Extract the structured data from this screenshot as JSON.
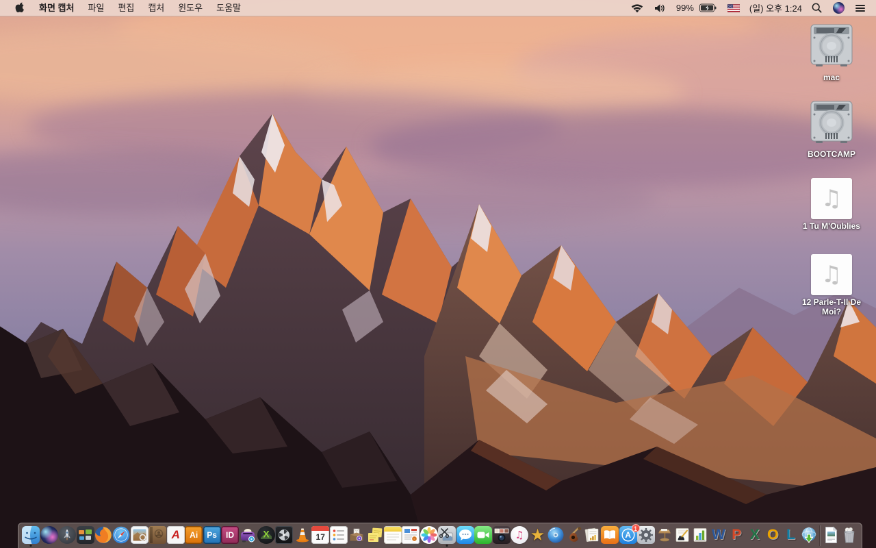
{
  "menu_bar": {
    "menus": [
      "화면 캡처",
      "파일",
      "편집",
      "캡처",
      "윈도우",
      "도움말"
    ],
    "active_app": "화면 캡처",
    "status": {
      "battery_percent": "99%",
      "clock": "(일) 오후 1:24"
    },
    "status_icons": [
      "wifi-icon",
      "volume-icon",
      "battery-charging-icon",
      "us-flag-input-icon",
      "spotlight-search-icon",
      "siri-icon",
      "notification-center-icon"
    ]
  },
  "desktop": {
    "audio_icon_glyph": "♫",
    "icons": [
      {
        "name": "hard-drive",
        "label": "mac"
      },
      {
        "name": "hard-drive",
        "label": "BOOTCAMP"
      },
      {
        "name": "audio-file",
        "label": "1 Tu M'Oublies"
      },
      {
        "name": "audio-file",
        "label": "12 Parle-T-Il De Moi?"
      }
    ]
  },
  "dock": {
    "items": [
      "finder",
      "siri",
      "launchpad",
      "mission-control",
      "firefox",
      "safari",
      "preview",
      "contacts",
      "adobe-reader",
      "adobe-illustrator",
      "adobe-photoshop",
      "adobe-indesign",
      "toast",
      "x-image-viewer",
      "disk-fan-utility",
      "vlc",
      "calendar",
      "reminders",
      "archive-box-app",
      "stickies",
      "notes",
      "newsletter-app",
      "photos",
      "grab-screen-capture",
      "messages",
      "facetime",
      "photo-booth",
      "itunes",
      "imovie",
      "idvd",
      "garageband",
      "documents-chart-app",
      "ibooks",
      "app-store",
      "system-preferences",
      "keynote",
      "pages",
      "numbers",
      "ms-word",
      "ms-powerpoint",
      "ms-excel",
      "ms-outlook",
      "ms-lync",
      "globe-download-app",
      "document-file",
      "trash-full"
    ],
    "running_apps": [
      "finder",
      "grab-screen-capture"
    ],
    "app_store_badge": "1",
    "glyphs": {
      "adobe_reader": "A",
      "illustrator": "Ai",
      "photoshop": "Ps",
      "indesign": "ID",
      "x_app": "X",
      "calendar_day": "17",
      "app_store": "A",
      "itunes_note": "♫",
      "imovie_star": "★",
      "word": "W",
      "powerpoint": "P",
      "excel": "X",
      "outlook": "O",
      "lync": "L"
    }
  },
  "colors": {
    "menu_bar_bg": "#ebd3ca",
    "dock_bg": "rgba(156,142,136,0.48)",
    "badge_red": "#e02d1f",
    "mountain_orange": "#d2703d"
  }
}
